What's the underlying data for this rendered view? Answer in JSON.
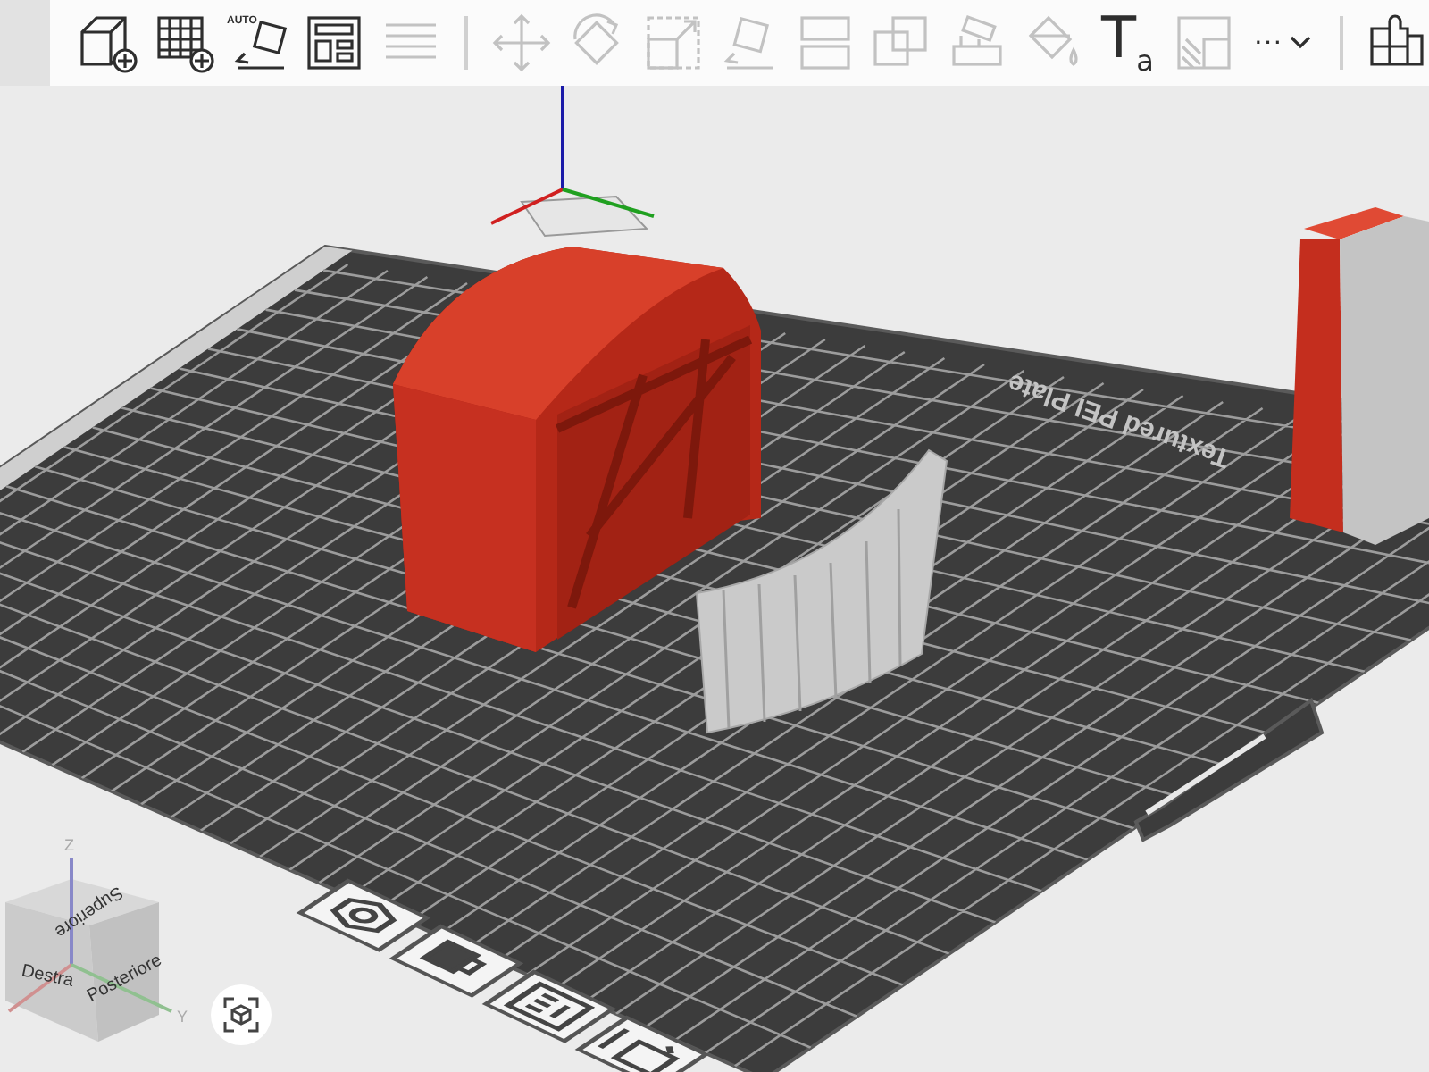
{
  "toolbar": {
    "items": [
      {
        "kind": "add-object",
        "disabled": false
      },
      {
        "kind": "add-plate",
        "disabled": false
      },
      {
        "kind": "auto-orient",
        "label": "AUTO",
        "disabled": false
      },
      {
        "kind": "arrange",
        "disabled": false
      },
      {
        "kind": "list",
        "disabled": true
      },
      {
        "kind": "separator"
      },
      {
        "kind": "move",
        "disabled": true
      },
      {
        "kind": "rotate",
        "disabled": true
      },
      {
        "kind": "scale",
        "disabled": true
      },
      {
        "kind": "lay-flat",
        "disabled": true
      },
      {
        "kind": "cut",
        "disabled": true
      },
      {
        "kind": "boolean",
        "disabled": true
      },
      {
        "kind": "supports",
        "disabled": true
      },
      {
        "kind": "paint",
        "disabled": true
      },
      {
        "kind": "text",
        "label": "T$_{a}$",
        "disabled": false
      },
      {
        "kind": "variable",
        "disabled": true
      },
      {
        "kind": "more",
        "label": "···",
        "disabled": false
      },
      {
        "kind": "separator"
      },
      {
        "kind": "assembly",
        "disabled": false
      }
    ]
  },
  "bed": {
    "label": "Textured PEI Plate"
  },
  "plate_buttons": [
    {
      "kind": "orient"
    },
    {
      "kind": "lock"
    },
    {
      "kind": "settings"
    },
    {
      "kind": "edit"
    }
  ],
  "view_cube": {
    "top": "Superiore",
    "right": "Destra",
    "back": "Posteriore",
    "axis_z": "Z",
    "axis_y": "Y"
  }
}
